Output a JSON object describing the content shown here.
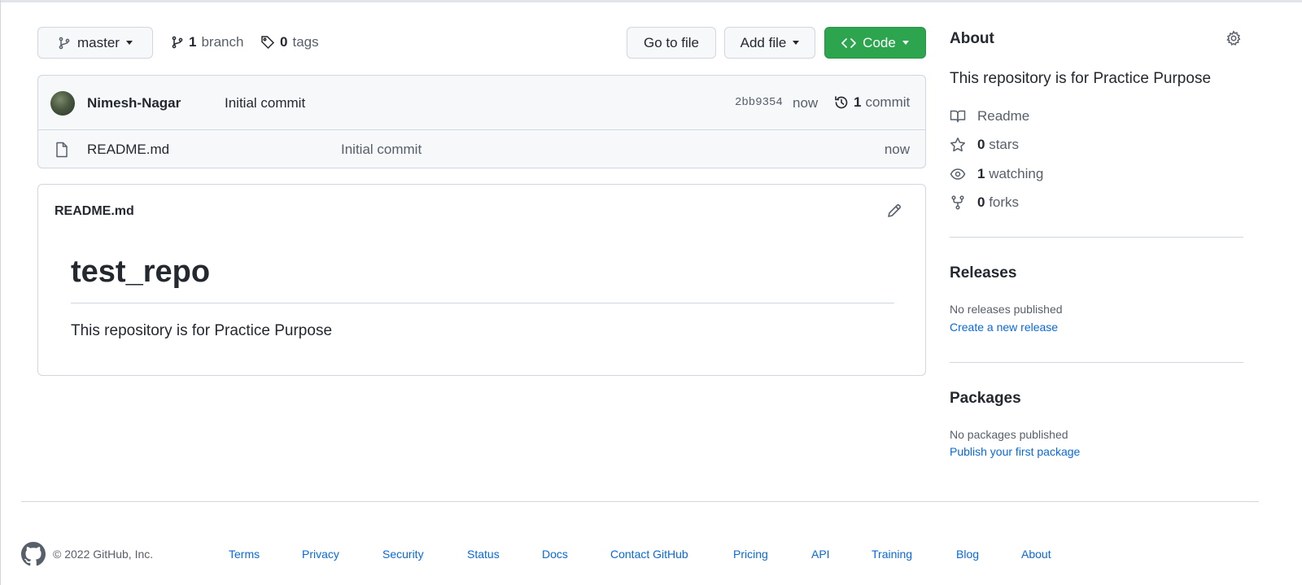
{
  "toolbar": {
    "branch_name": "master",
    "branch_count": "1",
    "branch_label": "branch",
    "tag_count": "0",
    "tag_label": "tags",
    "go_to_file": "Go to file",
    "add_file": "Add file",
    "code": "Code"
  },
  "latest_commit": {
    "author": "Nimesh-Nagar",
    "message": "Initial commit",
    "sha": "2bb9354",
    "time": "now",
    "commit_count": "1",
    "commit_label": "commit"
  },
  "files": [
    {
      "name": "README.md",
      "commit_message": "Initial commit",
      "time": "now"
    }
  ],
  "readme": {
    "filename": "README.md",
    "heading": "test_repo",
    "body": "This repository is for Practice Purpose"
  },
  "about": {
    "title": "About",
    "description": "This repository is for Practice Purpose",
    "readme_label": "Readme",
    "stars_count": "0",
    "stars_label": "stars",
    "watching_count": "1",
    "watching_label": "watching",
    "forks_count": "0",
    "forks_label": "forks"
  },
  "releases": {
    "title": "Releases",
    "note": "No releases published",
    "link": "Create a new release"
  },
  "packages": {
    "title": "Packages",
    "note": "No packages published",
    "link": "Publish your first package"
  },
  "footer": {
    "copyright": "© 2022 GitHub, Inc.",
    "links": [
      "Terms",
      "Privacy",
      "Security",
      "Status",
      "Docs",
      "Contact GitHub",
      "Pricing",
      "API",
      "Training",
      "Blog",
      "About"
    ]
  },
  "colors": {
    "accent_green": "#2da44e",
    "link_blue": "#0969da",
    "border": "#d0d7de"
  }
}
